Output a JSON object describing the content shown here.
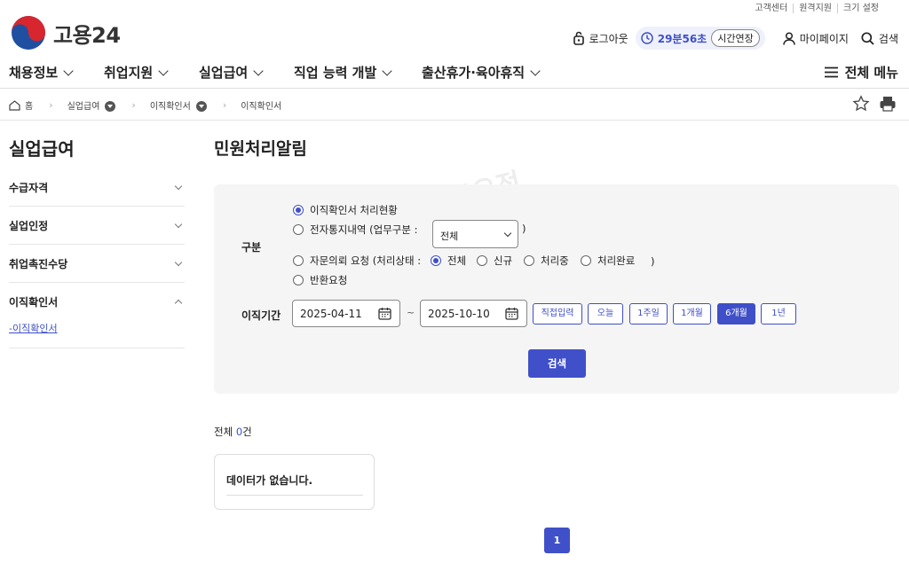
{
  "utility_links": [
    "고객센터",
    "원격지원",
    "크기 설정"
  ],
  "logo": {
    "text": "고용24"
  },
  "header": {
    "logout": "로그아웃",
    "timer": "29분56초",
    "extend": "시간연장",
    "mypage": "마이페이지",
    "search": "검색"
  },
  "gnb": {
    "items": [
      "채용정보",
      "취업지원",
      "실업급여",
      "직업 능력 개발",
      "출산휴가·육아휴직"
    ],
    "all_menu": "전체 메뉴"
  },
  "breadcrumb": {
    "home": "홈",
    "level1": "실업급여",
    "level2": "이직확인서",
    "current": "이직확인서"
  },
  "sidebar": {
    "title": "실업급여",
    "items": [
      "수급자격",
      "실업인정",
      "취업촉진수당",
      "이직확인서"
    ],
    "sub_item": "-이직확인서"
  },
  "main": {
    "title": "민원처리알림",
    "category_label": "구분",
    "options": {
      "opt1": "이직확인서 처리현황",
      "opt2_prefix": "전자통지내역 (업무구분 :",
      "opt2_suffix": ")",
      "opt3_prefix": "자문의뢰 요청 (처리상태 :",
      "opt3_suffix": ")",
      "opt4": "반환요청"
    },
    "business_select": "전체",
    "status_options": [
      "전체",
      "신규",
      "처리중",
      "처리완료"
    ],
    "period_label": "이직기간",
    "date_from": "2025-04-11",
    "date_to": "2025-10-10",
    "tilde": "~",
    "period_buttons": [
      "직접입력",
      "오늘",
      "1주일",
      "1개월",
      "6개월",
      "1년"
    ],
    "search_button": "검색",
    "total_prefix": "전체",
    "total_count": "0",
    "total_suffix": "건",
    "empty_message": "데이터가 없습니다.",
    "page": "1"
  },
  "watermark": "@재테크요정",
  "colors": {
    "accent": "#4050c9",
    "panel": "#f5f5f5"
  }
}
